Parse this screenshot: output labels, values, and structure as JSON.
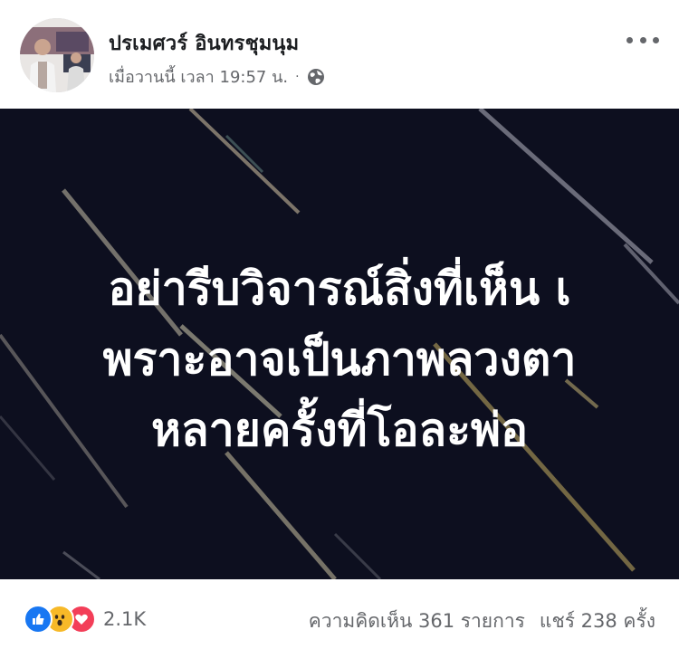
{
  "post": {
    "author": "ปรเมศวร์ อินทรชุมนุม",
    "timestamp": "เมื่อวานนี้ เวลา 19:57 น.",
    "separator": "·",
    "privacy_icon": "globe-icon",
    "more_icon": "more-options-icon"
  },
  "image": {
    "background_color": "#0d0f1f",
    "text_color": "#ffffff",
    "lines": [
      "อย่ารีบวิจารณ์สิ่งที่เห็น เ",
      "พราะอาจเป็นภาพลวงตา",
      "หลายครั้งที่โอละพ่อ"
    ]
  },
  "footer": {
    "reaction_icons": [
      "like-icon",
      "wow-icon",
      "love-icon"
    ],
    "reaction_count": "2.1K",
    "comments": "ความคิดเห็น 361 รายการ",
    "shares": "แชร์ 238 ครั้ง"
  },
  "colors": {
    "secondary_text": "#65676b",
    "like_blue": "#1877f2",
    "love_red": "#f33e58",
    "wow_yellow": "#f7b928"
  }
}
